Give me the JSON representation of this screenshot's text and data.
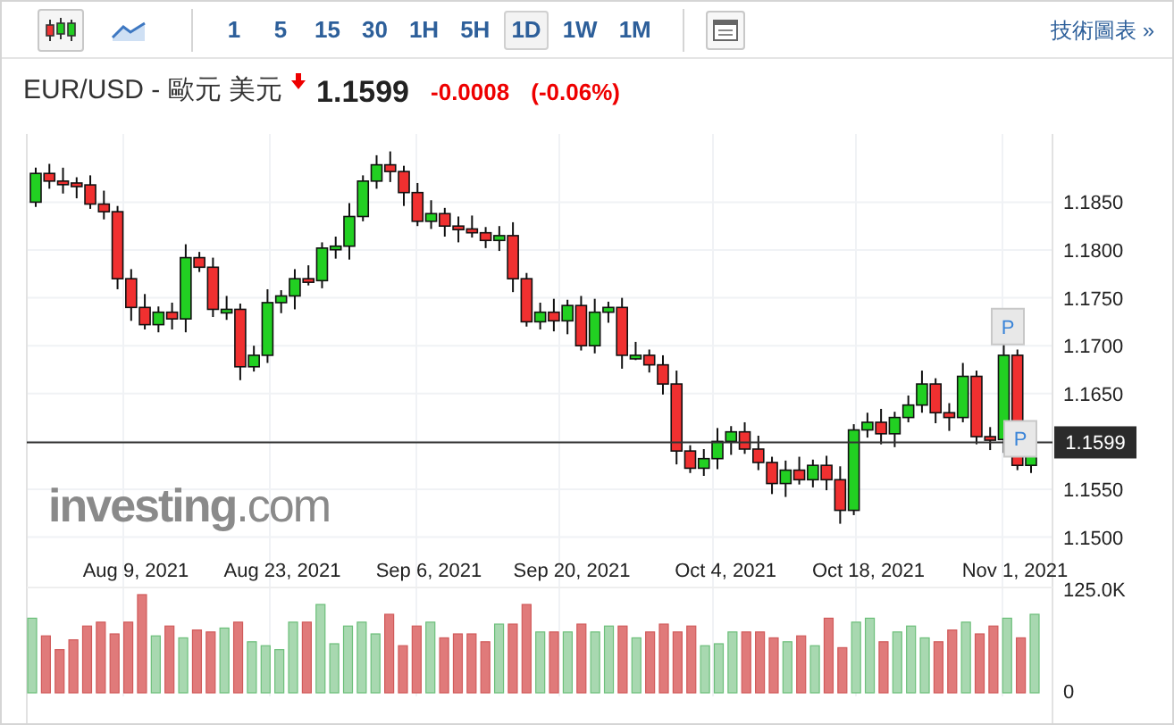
{
  "toolbar": {
    "chart_types": [
      {
        "kind": "candlestick",
        "selected": true
      },
      {
        "kind": "line",
        "selected": false
      }
    ],
    "intervals": [
      {
        "label": "1",
        "selected": false
      },
      {
        "label": "5",
        "selected": false
      },
      {
        "label": "15",
        "selected": false
      },
      {
        "label": "30",
        "selected": false
      },
      {
        "label": "1H",
        "selected": false
      },
      {
        "label": "5H",
        "selected": false
      },
      {
        "label": "1D",
        "selected": true
      },
      {
        "label": "1W",
        "selected": false
      },
      {
        "label": "1M",
        "selected": false
      }
    ],
    "link": "技術圖表 »"
  },
  "quote": {
    "symbol": "EUR/USD - 歐元 美元",
    "price": "1.1599",
    "change": "-0.0008",
    "change_percent": "(-0.06%)"
  },
  "chart": {
    "price_ticks": [
      "1.1850",
      "1.1800",
      "1.1750",
      "1.1700",
      "1.1650",
      "1.1550",
      "1.1500"
    ],
    "current_price": "1.1599",
    "date_labels": [
      "Aug 9, 2021",
      "Aug 23, 2021",
      "Sep 6, 2021",
      "Sep 20, 2021",
      "Oct 4, 2021",
      "Oct 18, 2021",
      "Nov 1, 2021"
    ],
    "volume_ticks": [
      "125.0K",
      "0"
    ],
    "markers": [
      "P",
      "P"
    ],
    "logo": "**investing**.com"
  }
}
